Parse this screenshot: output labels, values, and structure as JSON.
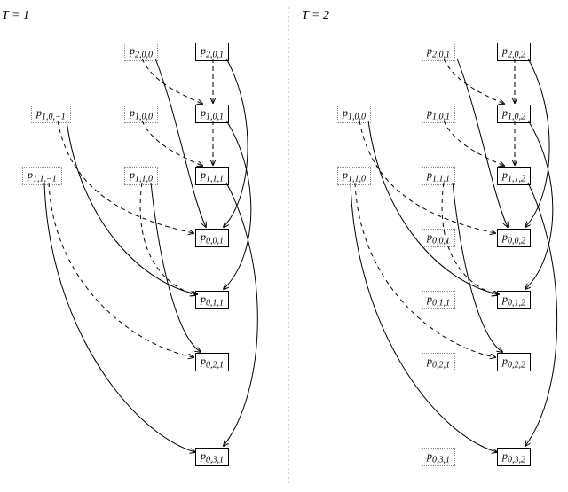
{
  "titles": {
    "left": "T = 1",
    "right": "T = 2"
  },
  "leftNodes": {
    "p200": "p",
    "p201": "p",
    "p10m1": "p",
    "p100": "p",
    "p101": "p",
    "p11m1": "p",
    "p110": "p",
    "p111": "p",
    "p001": "p",
    "p011": "p",
    "p021": "p",
    "p031": "p"
  },
  "leftSubs": {
    "p200": "2,0,0",
    "p201": "2,0,1",
    "p10m1": "1,0,−1",
    "p100": "1,0,0",
    "p101": "1,0,1",
    "p11m1": "1,1,−1",
    "p110": "1,1,0",
    "p111": "1,1,1",
    "p001": "0,0,1",
    "p011": "0,1,1",
    "p021": "0,2,1",
    "p031": "0,3,1"
  },
  "rightNodes": {
    "p201": "p",
    "p202": "p",
    "p100": "p",
    "p101": "p",
    "p102": "p",
    "p110": "p",
    "p111": "p",
    "p112": "p",
    "p001": "p",
    "p002": "p",
    "p011": "p",
    "p012": "p",
    "p021": "p",
    "p022": "p",
    "p031": "p",
    "p032": "p"
  },
  "rightSubs": {
    "p201": "2,0,1",
    "p202": "2,0,2",
    "p100": "1,0,0",
    "p101": "1,0,1",
    "p102": "1,0,2",
    "p110": "1,1,0",
    "p111": "1,1,1",
    "p112": "1,1,2",
    "p001": "0,0,1",
    "p002": "0,0,2",
    "p011": "0,1,1",
    "p012": "0,1,2",
    "p021": "0,2,1",
    "p022": "0,2,2",
    "p031": "0,3,1",
    "p032": "0,3,2"
  }
}
